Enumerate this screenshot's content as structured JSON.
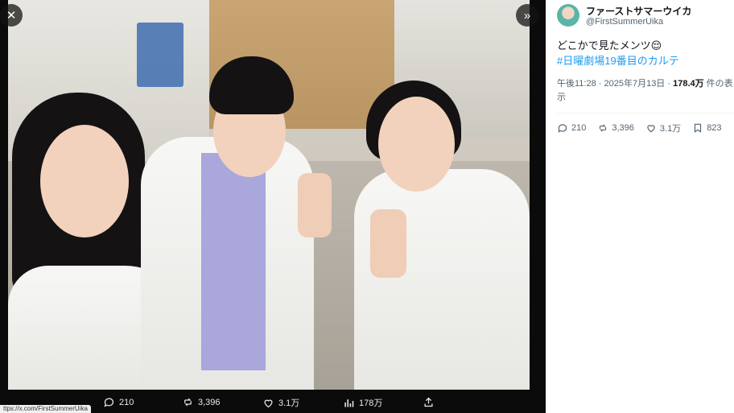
{
  "account": {
    "display_name": "ファーストサマーウイカ",
    "handle": "@FirstSummerUika"
  },
  "tweet": {
    "text": "どこかで見たメンツ😌",
    "hashtag": "#日曜劇場19番目のカルテ",
    "time": "午後11:28 · 2025年7月13日 · ",
    "views": "178.4万",
    "views_suffix": " 件の表示"
  },
  "panel_stats": {
    "replies": "210",
    "reposts": "3,396",
    "likes": "3.1万",
    "bookmarks": "823"
  },
  "media_bar": {
    "replies": "210",
    "reposts": "3,396",
    "likes": "3.1万",
    "views": "178万"
  },
  "status_url": "ttps://x.com/FirstSummerUika",
  "icons": {
    "close": "close-icon",
    "expand": "expand-icon",
    "reply": "reply-icon",
    "repost": "repost-icon",
    "like": "heart-icon",
    "views": "views-icon",
    "share": "share-icon",
    "bookmark": "bookmark-icon"
  },
  "colors": {
    "link": "#1d9bf0",
    "secondary_text": "#536471",
    "media_background": "#0b0b0b"
  }
}
